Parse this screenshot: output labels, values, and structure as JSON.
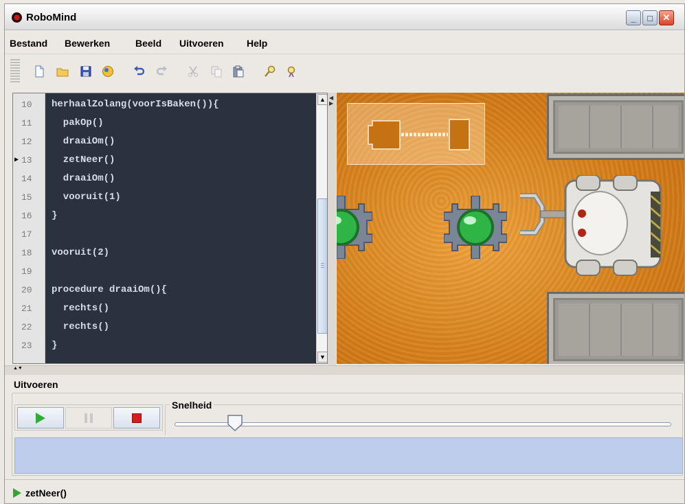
{
  "window": {
    "title": "RoboMind",
    "controls": [
      "minimize-icon",
      "maximize-icon",
      "close-icon"
    ]
  },
  "menu": [
    "Bestand",
    "Bewerken",
    "Beeld",
    "Uitvoeren",
    "Help"
  ],
  "toolbar": [
    "new-file-icon",
    "open-folder-icon",
    "save-icon",
    "world-icon",
    "undo-icon",
    "redo-icon",
    "cut-icon",
    "copy-icon",
    "paste-icon",
    "find-icon",
    "replace-icon"
  ],
  "editor": {
    "current_line": "13",
    "lines": [
      {
        "n": "10",
        "code": "herhaalZolang(voorIsBaken()){"
      },
      {
        "n": "11",
        "code": "  pakOp()"
      },
      {
        "n": "12",
        "code": "  draaiOm()"
      },
      {
        "n": "13",
        "code": "  zetNeer()"
      },
      {
        "n": "14",
        "code": "  draaiOm()"
      },
      {
        "n": "15",
        "code": "  vooruit(1)"
      },
      {
        "n": "16",
        "code": "}"
      },
      {
        "n": "17",
        "code": ""
      },
      {
        "n": "18",
        "code": "vooruit(2)"
      },
      {
        "n": "19",
        "code": ""
      },
      {
        "n": "20",
        "code": "procedure draaiOm(){"
      },
      {
        "n": "21",
        "code": "  rechts()"
      },
      {
        "n": "22",
        "code": "  rechts()"
      },
      {
        "n": "23",
        "code": "}"
      }
    ]
  },
  "run_panel": {
    "title": "Uitvoeren",
    "speed_label": "Snelheid",
    "speed_fraction": 0.12,
    "buttons": [
      "play-icon",
      "pause-icon",
      "stop-icon"
    ]
  },
  "status": {
    "text": "zetNeer()"
  },
  "colors": {
    "editor_bg": "#2b323f",
    "world_sand": "#e08a24",
    "output_bg": "#bfcdec",
    "play_green": "#34a534",
    "stop_red": "#d41e1e"
  }
}
